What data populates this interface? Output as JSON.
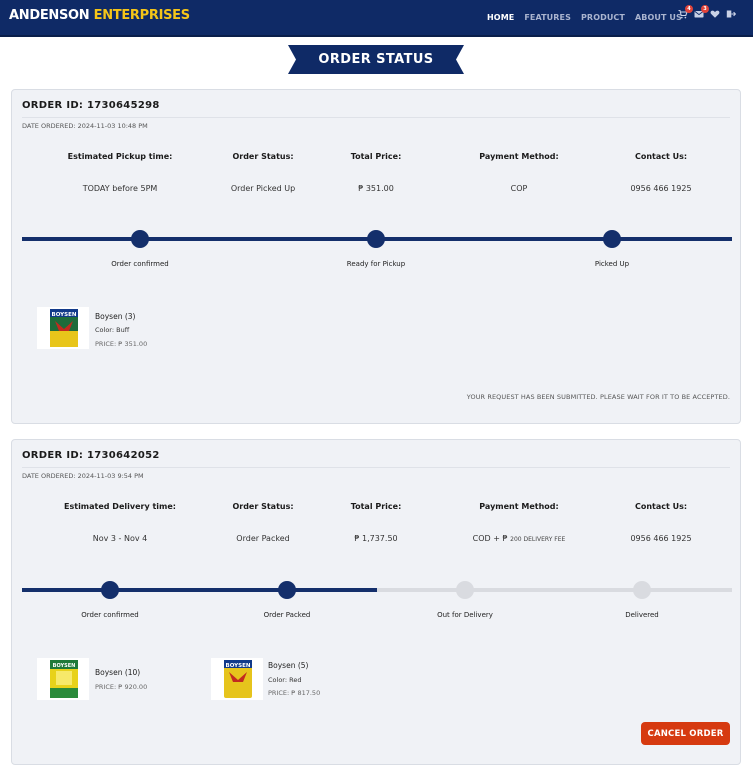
{
  "header": {
    "brand_part1": "ANDENSON",
    "brand_part2": "ENTERPRISES",
    "nav": [
      {
        "label": "HOME",
        "active": true
      },
      {
        "label": "FEATURES",
        "active": false
      },
      {
        "label": "PRODUCT",
        "active": false
      },
      {
        "label": "ABOUT US",
        "active": false
      }
    ],
    "icons": [
      {
        "name": "cart-icon",
        "badge": "4"
      },
      {
        "name": "mail-icon",
        "badge": "3"
      },
      {
        "name": "heart-icon",
        "badge": ""
      },
      {
        "name": "logout-icon",
        "badge": ""
      }
    ]
  },
  "page_title": "ORDER STATUS",
  "colors": {
    "navy": "#0f2a66",
    "accent_yellow": "#f5c518",
    "cancel_red": "#d63a10"
  },
  "orders": [
    {
      "order_id": "ORDER ID: 1730645298",
      "date": "DATE ORDERED: 2024-11-03 10:48 PM",
      "info": [
        {
          "head": "Estimated Pickup time:",
          "value": "TODAY before 5PM"
        },
        {
          "head": "Order Status:",
          "value": "Order Picked Up"
        },
        {
          "head": "Total Price:",
          "value": "₱ 351.00"
        },
        {
          "head": "Payment Method:",
          "value": "COP"
        },
        {
          "head": "Contact Us:",
          "value": "0956 466 1925"
        }
      ],
      "steps": [
        {
          "label": "Order confirmed",
          "done": true
        },
        {
          "label": "Ready for Pickup",
          "done": true
        },
        {
          "label": "Picked Up",
          "done": true
        }
      ],
      "products": [
        {
          "name": "Boysen (3)",
          "color": "Color: Buff",
          "price": "PRICE: ₱ 351.00"
        }
      ],
      "notice": "YOUR REQUEST HAS BEEN SUBMITTED. PLEASE WAIT FOR IT TO BE ACCEPTED."
    },
    {
      "order_id": "ORDER ID: 1730642052",
      "date": "DATE ORDERED: 2024-11-03 9:54 PM",
      "info": [
        {
          "head": "Estimated Delivery time:",
          "value": "Nov 3 - Nov 4"
        },
        {
          "head": "Order Status:",
          "value": "Order Packed"
        },
        {
          "head": "Total Price:",
          "value": "₱ 1,737.50"
        },
        {
          "head": "Payment Method:",
          "value": "COD + ₱",
          "value_small": "200 DELIVERY FEE"
        },
        {
          "head": "Contact Us:",
          "value": "0956 466 1925"
        }
      ],
      "steps": [
        {
          "label": "Order confirmed",
          "done": true
        },
        {
          "label": "Order Packed",
          "done": true
        },
        {
          "label": "Out for Delivery",
          "done": false
        },
        {
          "label": "Delivered",
          "done": false
        }
      ],
      "products": [
        {
          "name": "Boysen (10)",
          "color": "",
          "price": "PRICE: ₱ 920.00"
        },
        {
          "name": "Boysen (5)",
          "color": "Color: Red",
          "price": "PRICE: ₱ 817.50"
        }
      ],
      "cancel_label": "CANCEL ORDER"
    }
  ]
}
